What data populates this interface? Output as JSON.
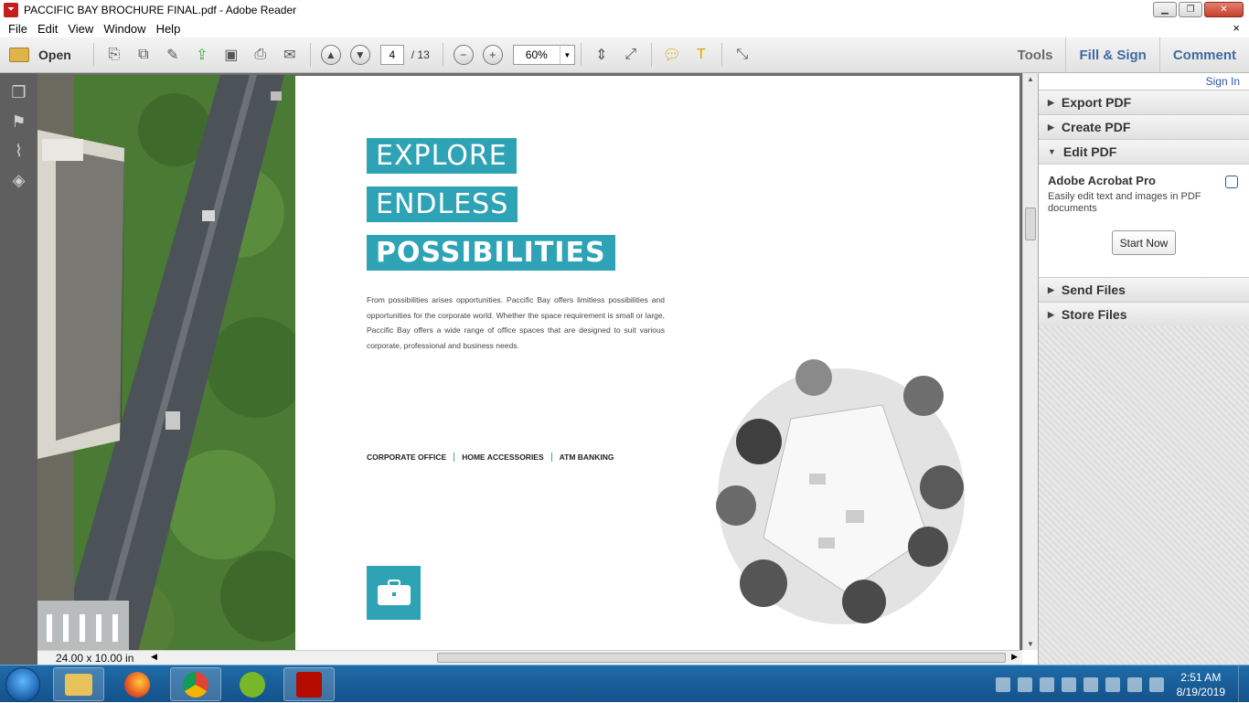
{
  "window": {
    "title": "PACCIFIC BAY BROCHURE FINAL.pdf - Adobe Reader",
    "min_label": "▁",
    "max_label": "❐",
    "close_label": "✕"
  },
  "menu": {
    "items": [
      "File",
      "Edit",
      "View",
      "Window",
      "Help"
    ],
    "close": "×"
  },
  "toolbar": {
    "open_label": "Open",
    "page_current": "4",
    "page_total": "/ 13",
    "zoom": "60%",
    "tabs": [
      "Tools",
      "Fill & Sign",
      "Comment"
    ]
  },
  "document": {
    "headline": [
      "EXPLORE",
      "ENDLESS",
      "POSSIBILITIES"
    ],
    "paragraph": "From possibilities arises opportunities. Paccific Bay offers limitless possibilities and opportunities for the corporate world. Whether the space requirement is small or large, Paccific Bay offers a wide range of office spaces that are designed to suit various corporate, professional and business needs.",
    "categories": [
      "CORPORATE OFFICE",
      "HOME ACCESSORIES",
      "ATM BANKING"
    ],
    "page_size": "24.00 x 10.00 in",
    "accent_color": "#2fa3b6"
  },
  "right_panel": {
    "sign_in": "Sign In",
    "sections_top": [
      "Export PDF",
      "Create PDF"
    ],
    "edit_pdf": {
      "title": "Edit PDF",
      "heading": "Adobe Acrobat Pro",
      "description": "Easily edit text and images in PDF documents",
      "button": "Start Now"
    },
    "sections_bottom": [
      "Send Files",
      "Store Files"
    ]
  },
  "taskbar": {
    "apps": [
      "windows-explorer",
      "firefox",
      "chrome",
      "utorrent",
      "adobe-reader"
    ],
    "time": "2:51 AM",
    "date": "8/19/2019"
  }
}
